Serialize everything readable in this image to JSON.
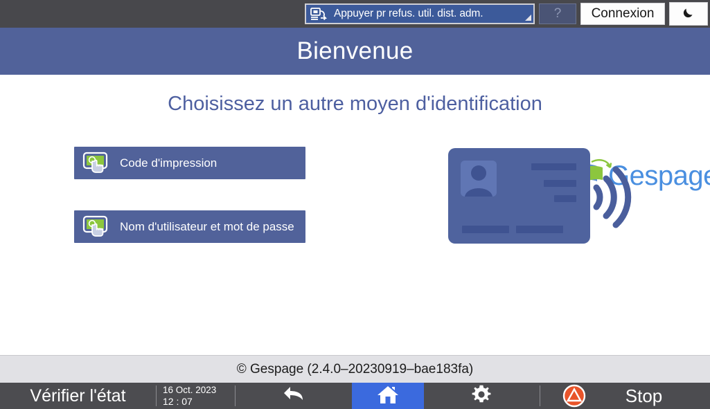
{
  "topbar": {
    "mode_select": {
      "icon": "printer-transfer-icon",
      "label": "Appuyer pr refus. util. dist. adm.",
      "corner_marker": "dropdown-corner-triangle"
    },
    "help_label": "?",
    "login_label": "Connexion",
    "sleep_icon": "moon-icon"
  },
  "banner": {
    "title": "Bienvenue",
    "bg_color": "#51629a"
  },
  "main": {
    "subtitle": "Choisissez un autre moyen d'identification",
    "subtitle_color": "#4d5fa0",
    "logo": {
      "brand": "Gespage",
      "text_color": "#4a8fe0",
      "swoosh_blue": "#5b8fd4",
      "swoosh_green": "#8cc63e",
      "arc_color": "#8cc63e"
    },
    "choices": [
      {
        "icon": "touchscreen-tap-icon",
        "label": "Code d'impression"
      },
      {
        "icon": "touchscreen-tap-icon",
        "label": "Nom d'utilisateur et mot de passe"
      }
    ],
    "badge_art": {
      "name": "contactless-id-card-illustration",
      "card_color": "#4f639e",
      "wave_color": "#4a5e9c"
    }
  },
  "footer": {
    "copyright": "© Gespage (2.4.0–20230919–bae183fa)",
    "bg_color": "#e1e1e5"
  },
  "navbar": {
    "status_label": "Vérifier l'état",
    "date": "16 Oct. 2023",
    "time": "12 : 07",
    "back_icon": "back-arrow-icon",
    "home_icon": "home-icon",
    "home_active_color": "#3b6ade",
    "settings_icon": "gear-icon",
    "stop_icon": "stop-icon",
    "stop_label": "Stop",
    "stop_icon_color": "#e8542a"
  }
}
